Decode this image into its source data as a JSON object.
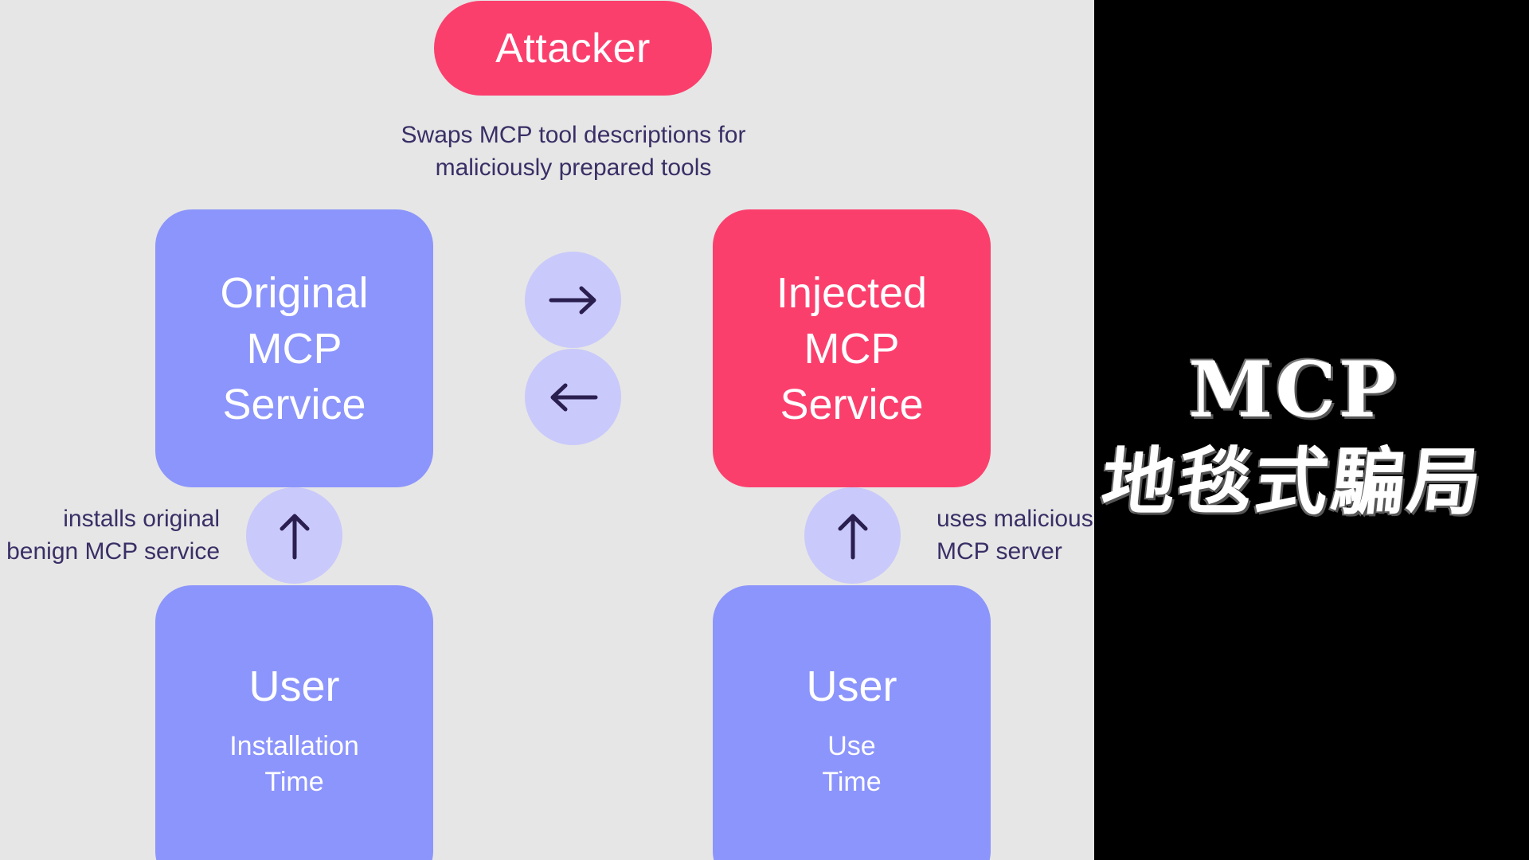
{
  "diagram": {
    "attacker_label": "Attacker",
    "attacker_caption": "Swaps MCP tool descriptions for\nmaliciously prepared tools",
    "original_service_label": "Original\nMCP\nService",
    "injected_service_label": "Injected\nMCP\nService",
    "left_caption": "installs original\nbenign MCP service",
    "right_caption": "uses malicious\nMCP server",
    "left_user": {
      "title": "User",
      "subtitle": "Installation\nTime"
    },
    "right_user": {
      "title": "User",
      "subtitle": "Use\nTime"
    },
    "arrow_icons": [
      "arrow-right-icon",
      "arrow-left-icon",
      "arrow-up-icon",
      "arrow-up-icon"
    ]
  },
  "overlay": {
    "title_line1": "MCP",
    "title_line2": "地毯式騙局"
  },
  "colors": {
    "canvas_bg": "#e6e6e6",
    "side_bg": "#000000",
    "pink": "#fb3f6d",
    "blue": "#8c95fb",
    "circle": "#c9c9fb",
    "caption_text": "#3a2f66",
    "arrow_stroke": "#2a1f4f"
  }
}
